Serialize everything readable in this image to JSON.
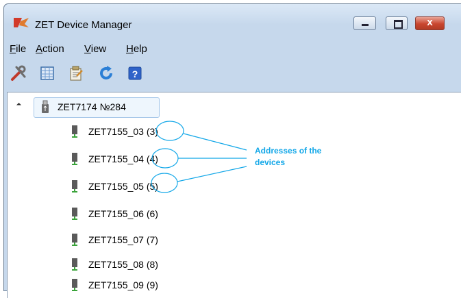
{
  "window": {
    "title": "ZET Device Manager",
    "controls": [
      "minimize",
      "maximize",
      "close"
    ],
    "close_glyph": "x"
  },
  "menu": [
    "File",
    "Action",
    "View",
    "Help"
  ],
  "toolbar": [
    {
      "icon": "tools-icon"
    },
    {
      "icon": "table-icon"
    },
    {
      "icon": "properties-icon"
    },
    {
      "icon": "refresh-icon"
    },
    {
      "icon": "help-icon",
      "text": "?"
    }
  ],
  "tree": {
    "root": {
      "label": "ZET7174 №284",
      "icon": "usb-icon",
      "expanded": true
    },
    "devices": [
      {
        "label": "ZET7155_03 (3)"
      },
      {
        "label": "ZET7155_04 (4)"
      },
      {
        "label": "ZET7155_05 (5)"
      },
      {
        "label": "ZET7155_06 (6)"
      },
      {
        "label": "ZET7155_07 (7)"
      },
      {
        "label": "ZET7155_08 (8)"
      },
      {
        "label": "ZET7155_09 (9)"
      }
    ]
  },
  "annotation": {
    "text_line1": "Addresses of the",
    "text_line2": "devices",
    "color": "#12a7e8"
  },
  "colors": {
    "accent": "#12a7e8",
    "selection_fill": "#eef6fd",
    "selection_border": "#a6c7e9",
    "close_button": "#c9462f"
  }
}
